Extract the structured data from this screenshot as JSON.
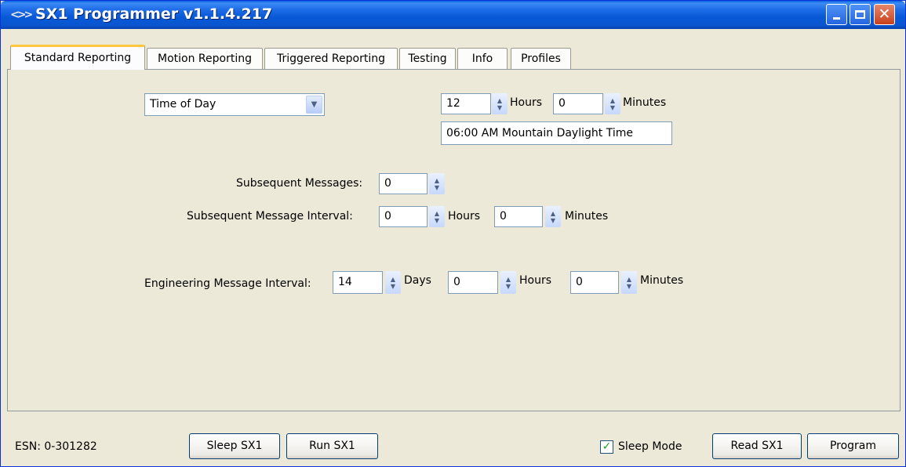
{
  "window": {
    "title": "SX1 Programmer v1.1.4.217"
  },
  "tabs": [
    {
      "label": "Standard Reporting"
    },
    {
      "label": "Motion Reporting"
    },
    {
      "label": "Triggered Reporting"
    },
    {
      "label": "Testing"
    },
    {
      "label": "Info"
    },
    {
      "label": "Profiles"
    }
  ],
  "standard": {
    "mode_select": "Time of Day",
    "time": {
      "hours": "12",
      "hours_label": "Hours",
      "minutes": "0",
      "minutes_label": "Minutes"
    },
    "time_display": "06:00 AM Mountain Daylight Time",
    "subsequent_messages": {
      "label": "Subsequent Messages:",
      "value": "0"
    },
    "subsequent_interval": {
      "label": "Subsequent Message Interval:",
      "hours": "0",
      "hours_label": "Hours",
      "minutes": "0",
      "minutes_label": "Minutes"
    },
    "engineering_interval": {
      "label": "Engineering Message Interval:",
      "days": "14",
      "days_label": "Days",
      "hours": "0",
      "hours_label": "Hours",
      "minutes": "0",
      "minutes_label": "Minutes"
    }
  },
  "footer": {
    "esn": "ESN: 0-301282",
    "sleep_button": "Sleep SX1",
    "run_button": "Run SX1",
    "sleep_mode_label": "Sleep Mode",
    "sleep_mode_checked": true,
    "read_button": "Read SX1",
    "program_button": "Program"
  }
}
